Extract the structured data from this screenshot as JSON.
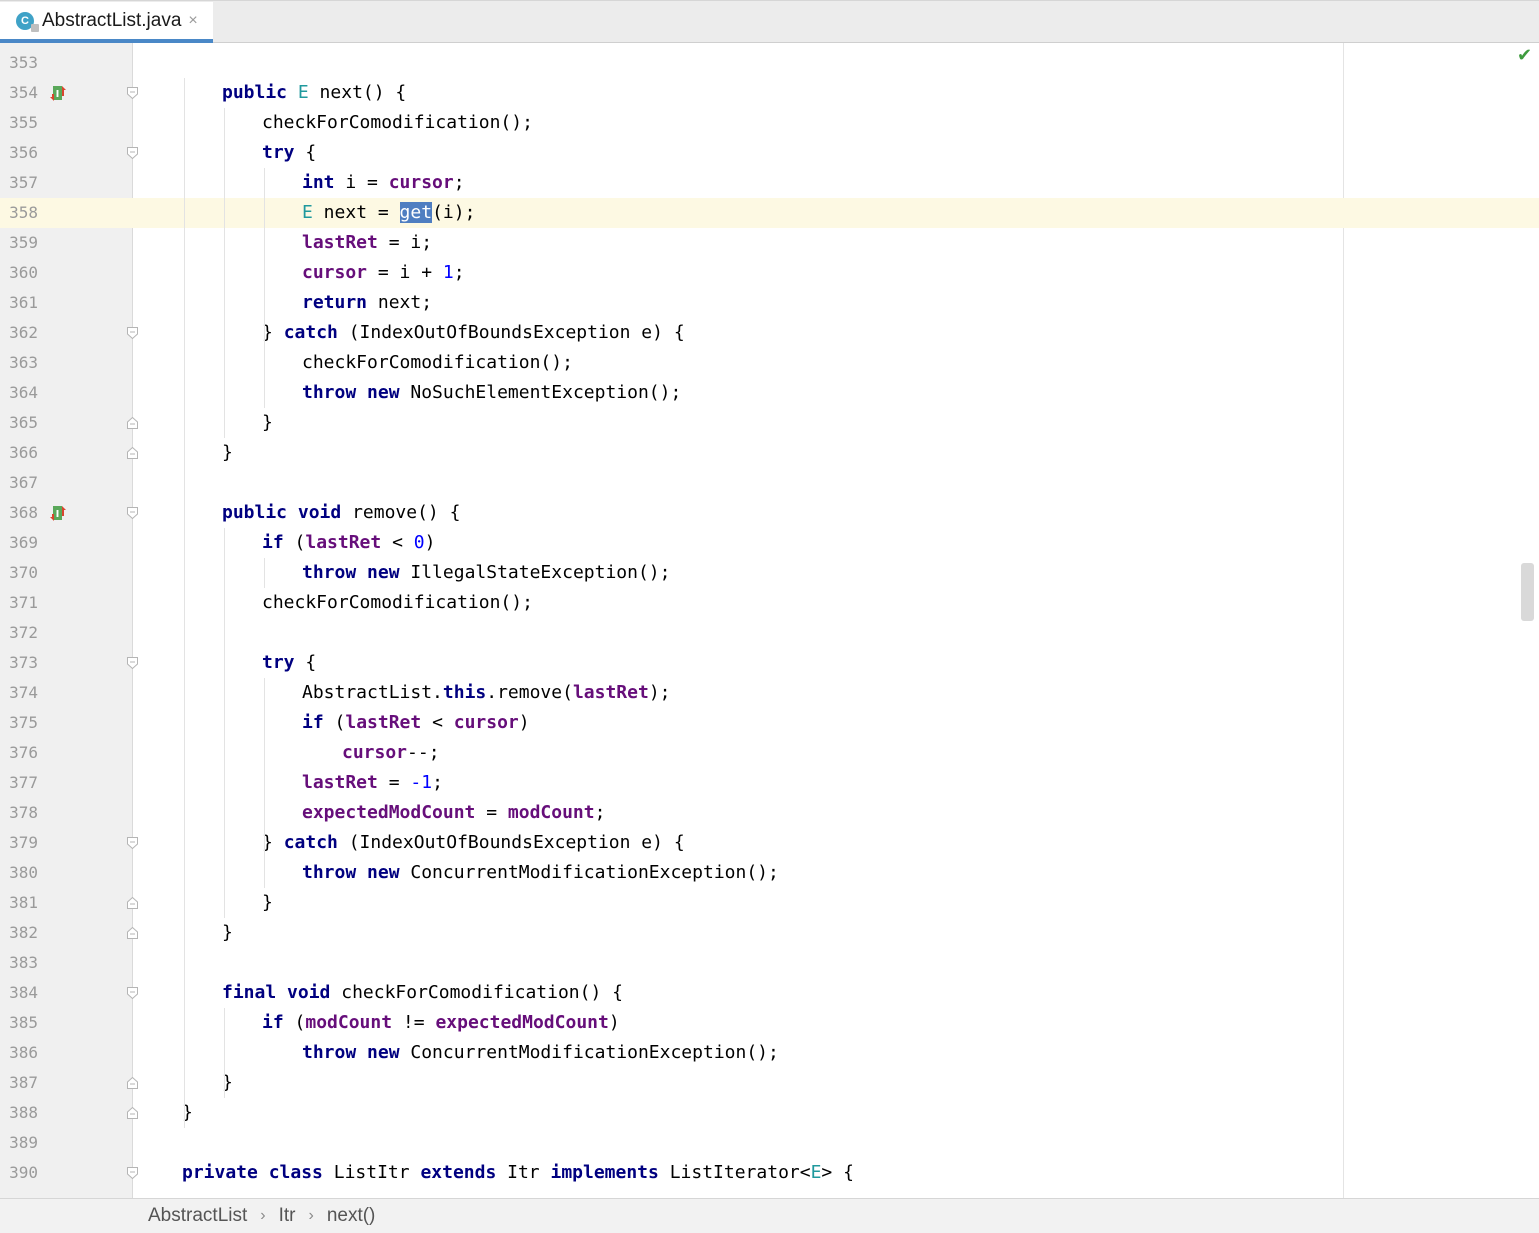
{
  "tab": {
    "icon_letter": "C",
    "filename": "AbstractList.java",
    "close_glyph": "×"
  },
  "inspection": {
    "icon": "check-icon",
    "color": "#3e9b3e"
  },
  "current_line": 358,
  "code_lines": [
    {
      "n": "353",
      "fold": "",
      "bm": false,
      "segs": []
    },
    {
      "n": "354",
      "fold": "open",
      "bm": true,
      "segs": [
        [
          "kw",
          "public"
        ],
        [
          "p",
          " "
        ],
        [
          "tp",
          "E"
        ],
        [
          "p",
          " next() {"
        ]
      ]
    },
    {
      "n": "355",
      "fold": "",
      "bm": false,
      "segs": [
        [
          "p",
          "checkForComodification();"
        ]
      ]
    },
    {
      "n": "356",
      "fold": "open",
      "bm": false,
      "segs": [
        [
          "kw",
          "try"
        ],
        [
          "p",
          " {"
        ]
      ]
    },
    {
      "n": "357",
      "fold": "",
      "bm": false,
      "segs": [
        [
          "kw",
          "int"
        ],
        [
          "p",
          " i = "
        ],
        [
          "fld",
          "cursor"
        ],
        [
          "p",
          ";"
        ]
      ]
    },
    {
      "n": "358",
      "fold": "",
      "bm": false,
      "segs": [
        [
          "tp",
          "E"
        ],
        [
          "p",
          " next = "
        ],
        [
          "hl",
          "get"
        ],
        [
          "p",
          "(i);"
        ]
      ]
    },
    {
      "n": "359",
      "fold": "",
      "bm": false,
      "segs": [
        [
          "fld",
          "lastRet"
        ],
        [
          "p",
          " = i;"
        ]
      ]
    },
    {
      "n": "360",
      "fold": "",
      "bm": false,
      "segs": [
        [
          "fld",
          "cursor"
        ],
        [
          "p",
          " = i + "
        ],
        [
          "num",
          "1"
        ],
        [
          "p",
          ";"
        ]
      ]
    },
    {
      "n": "361",
      "fold": "",
      "bm": false,
      "segs": [
        [
          "kw",
          "return"
        ],
        [
          "p",
          " next;"
        ]
      ]
    },
    {
      "n": "362",
      "fold": "open",
      "bm": false,
      "segs": [
        [
          "p",
          "} "
        ],
        [
          "kw",
          "catch"
        ],
        [
          "p",
          " (IndexOutOfBoundsException e) {"
        ]
      ]
    },
    {
      "n": "363",
      "fold": "",
      "bm": false,
      "segs": [
        [
          "p",
          "checkForComodification();"
        ]
      ]
    },
    {
      "n": "364",
      "fold": "",
      "bm": false,
      "segs": [
        [
          "kw",
          "throw"
        ],
        [
          "p",
          " "
        ],
        [
          "kw",
          "new"
        ],
        [
          "p",
          " NoSuchElementException();"
        ]
      ]
    },
    {
      "n": "365",
      "fold": "close",
      "bm": false,
      "segs": [
        [
          "p",
          "}"
        ]
      ]
    },
    {
      "n": "366",
      "fold": "close",
      "bm": false,
      "segs": [
        [
          "p",
          "}"
        ]
      ]
    },
    {
      "n": "367",
      "fold": "",
      "bm": false,
      "segs": []
    },
    {
      "n": "368",
      "fold": "open",
      "bm": true,
      "segs": [
        [
          "kw",
          "public"
        ],
        [
          "p",
          " "
        ],
        [
          "kw",
          "void"
        ],
        [
          "p",
          " remove() {"
        ]
      ]
    },
    {
      "n": "369",
      "fold": "",
      "bm": false,
      "segs": [
        [
          "kw",
          "if"
        ],
        [
          "p",
          " ("
        ],
        [
          "fld",
          "lastRet"
        ],
        [
          "p",
          " < "
        ],
        [
          "num",
          "0"
        ],
        [
          "p",
          ")"
        ]
      ]
    },
    {
      "n": "370",
      "fold": "",
      "bm": false,
      "segs": [
        [
          "kw",
          "throw"
        ],
        [
          "p",
          " "
        ],
        [
          "kw",
          "new"
        ],
        [
          "p",
          " IllegalStateException();"
        ]
      ]
    },
    {
      "n": "371",
      "fold": "",
      "bm": false,
      "segs": [
        [
          "p",
          "checkForComodification();"
        ]
      ]
    },
    {
      "n": "372",
      "fold": "",
      "bm": false,
      "segs": []
    },
    {
      "n": "373",
      "fold": "open",
      "bm": false,
      "segs": [
        [
          "kw",
          "try"
        ],
        [
          "p",
          " {"
        ]
      ]
    },
    {
      "n": "374",
      "fold": "",
      "bm": false,
      "segs": [
        [
          "p",
          "AbstractList."
        ],
        [
          "kw",
          "this"
        ],
        [
          "p",
          ".remove("
        ],
        [
          "fld",
          "lastRet"
        ],
        [
          "p",
          ");"
        ]
      ]
    },
    {
      "n": "375",
      "fold": "",
      "bm": false,
      "segs": [
        [
          "kw",
          "if"
        ],
        [
          "p",
          " ("
        ],
        [
          "fld",
          "lastRet"
        ],
        [
          "p",
          " < "
        ],
        [
          "fld",
          "cursor"
        ],
        [
          "p",
          ")"
        ]
      ]
    },
    {
      "n": "376",
      "fold": "",
      "bm": false,
      "segs": [
        [
          "fld",
          "cursor"
        ],
        [
          "p",
          "--;"
        ]
      ]
    },
    {
      "n": "377",
      "fold": "",
      "bm": false,
      "segs": [
        [
          "fld",
          "lastRet"
        ],
        [
          "p",
          " = "
        ],
        [
          "num",
          "-1"
        ],
        [
          "p",
          ";"
        ]
      ]
    },
    {
      "n": "378",
      "fold": "",
      "bm": false,
      "segs": [
        [
          "fld",
          "expectedModCount"
        ],
        [
          "p",
          " = "
        ],
        [
          "fld",
          "modCount"
        ],
        [
          "p",
          ";"
        ]
      ]
    },
    {
      "n": "379",
      "fold": "open",
      "bm": false,
      "segs": [
        [
          "p",
          "} "
        ],
        [
          "kw",
          "catch"
        ],
        [
          "p",
          " (IndexOutOfBoundsException e) {"
        ]
      ]
    },
    {
      "n": "380",
      "fold": "",
      "bm": false,
      "segs": [
        [
          "kw",
          "throw"
        ],
        [
          "p",
          " "
        ],
        [
          "kw",
          "new"
        ],
        [
          "p",
          " ConcurrentModificationException();"
        ]
      ]
    },
    {
      "n": "381",
      "fold": "close",
      "bm": false,
      "segs": [
        [
          "p",
          "}"
        ]
      ]
    },
    {
      "n": "382",
      "fold": "close",
      "bm": false,
      "segs": [
        [
          "p",
          "}"
        ]
      ]
    },
    {
      "n": "383",
      "fold": "",
      "bm": false,
      "segs": []
    },
    {
      "n": "384",
      "fold": "open",
      "bm": false,
      "segs": [
        [
          "kw",
          "final"
        ],
        [
          "p",
          " "
        ],
        [
          "kw",
          "void"
        ],
        [
          "p",
          " checkForComodification() {"
        ]
      ]
    },
    {
      "n": "385",
      "fold": "",
      "bm": false,
      "segs": [
        [
          "kw",
          "if"
        ],
        [
          "p",
          " ("
        ],
        [
          "fld",
          "modCount"
        ],
        [
          "p",
          " != "
        ],
        [
          "fld",
          "expectedModCount"
        ],
        [
          "p",
          ")"
        ]
      ]
    },
    {
      "n": "386",
      "fold": "",
      "bm": false,
      "segs": [
        [
          "kw",
          "throw"
        ],
        [
          "p",
          " "
        ],
        [
          "kw",
          "new"
        ],
        [
          "p",
          " ConcurrentModificationException();"
        ]
      ]
    },
    {
      "n": "387",
      "fold": "close",
      "bm": false,
      "segs": [
        [
          "p",
          "}"
        ]
      ]
    },
    {
      "n": "388",
      "fold": "close",
      "bm": false,
      "segs": [
        [
          "p",
          "}"
        ]
      ]
    },
    {
      "n": "389",
      "fold": "",
      "bm": false,
      "segs": []
    },
    {
      "n": "390",
      "fold": "open",
      "bm": false,
      "segs": [
        [
          "kw",
          "private"
        ],
        [
          "p",
          " "
        ],
        [
          "kw",
          "class"
        ],
        [
          "p",
          " ListItr "
        ],
        [
          "kw",
          "extends"
        ],
        [
          "p",
          " Itr "
        ],
        [
          "kw",
          "implements"
        ],
        [
          "p",
          " ListIterator<"
        ],
        [
          "tp",
          "E"
        ],
        [
          "p",
          "> {"
        ]
      ]
    }
  ],
  "breadcrumb": [
    "AbstractList",
    "Itr",
    "next()"
  ],
  "breadcrumb_sep": "›",
  "colors": {
    "keyword": "#000080",
    "field": "#660e7a",
    "number": "#0000ff",
    "type_param": "#20999d",
    "selection": "#4f7ec1",
    "current_line": "#fdf9e3"
  }
}
